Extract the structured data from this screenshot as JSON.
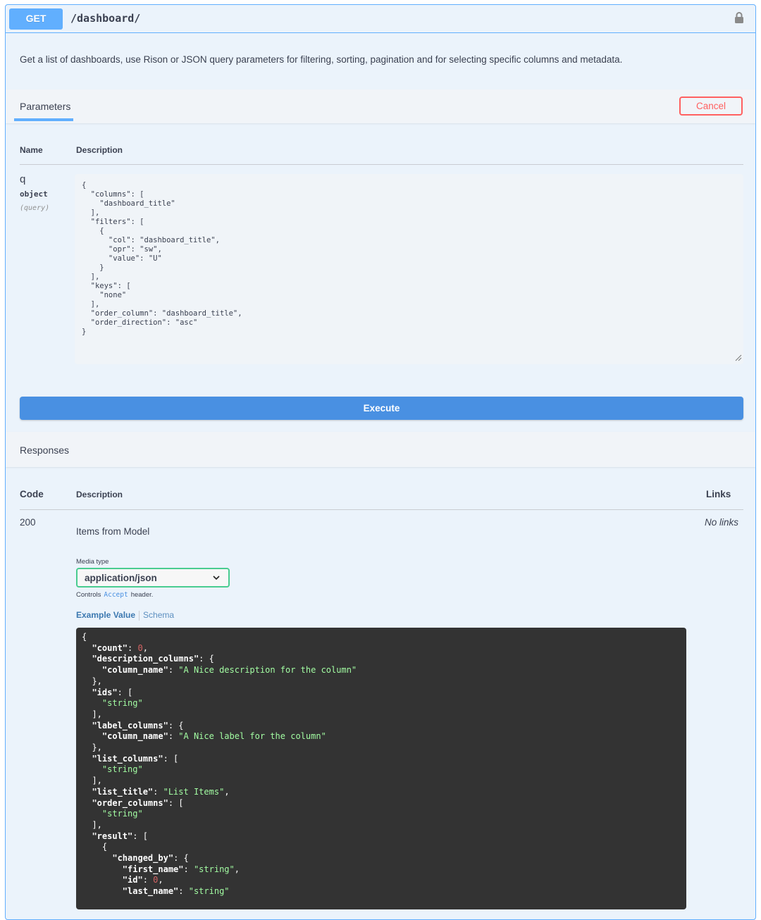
{
  "operation": {
    "method": "GET",
    "path": "/dashboard/",
    "description": "Get a list of dashboards, use Rison or JSON query parameters for filtering, sorting, pagination and for selecting specific columns and metadata."
  },
  "parameters": {
    "tab_label": "Parameters",
    "cancel_label": "Cancel",
    "col_name": "Name",
    "col_description": "Description",
    "param": {
      "name": "q",
      "type": "object",
      "in": "(query)",
      "value": "{\n  \"columns\": [\n    \"dashboard_title\"\n  ],\n  \"filters\": [\n    {\n      \"col\": \"dashboard_title\",\n      \"opr\": \"sw\",\n      \"value\": \"U\"\n    }\n  ],\n  \"keys\": [\n    \"none\"\n  ],\n  \"order_column\": \"dashboard_title\",\n  \"order_direction\": \"asc\"\n}"
    },
    "execute_label": "Execute"
  },
  "responses": {
    "title": "Responses",
    "col_code": "Code",
    "col_description": "Description",
    "col_links": "Links",
    "row": {
      "code": "200",
      "description": "Items from Model",
      "links": "No links"
    },
    "media_type_label": "Media type",
    "media_type_value": "application/json",
    "controls_prefix": "Controls",
    "controls_accept": "Accept",
    "controls_suffix": "header.",
    "tab_example": "Example Value",
    "tab_schema": "Schema"
  },
  "colors": {
    "get_blue": "#61affe",
    "execute_blue": "#4990e2",
    "cancel_red": "#ff6060",
    "code_bg": "#333333",
    "string_green": "#a2fca2",
    "number_red": "#d36363"
  }
}
